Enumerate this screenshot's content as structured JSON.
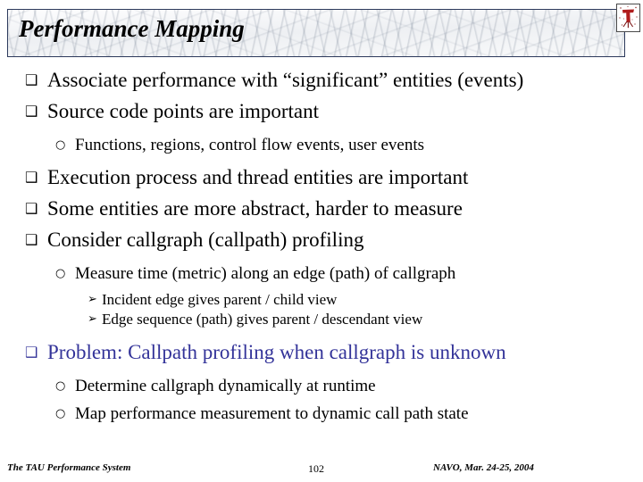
{
  "slide": {
    "title": "Performance Mapping",
    "logo_icon": "tau-logo-icon",
    "accent_color": "#333399",
    "title_border_color": "#2d3a5c",
    "text_color": "#000000"
  },
  "markers": {
    "level1": "❑",
    "level2": "○",
    "level3": "➢"
  },
  "bullets": [
    {
      "level": 1,
      "text": "Associate performance with “significant” entities (events)",
      "color": "#000000"
    },
    {
      "level": 1,
      "text": "Source code points are important",
      "color": "#000000"
    },
    {
      "level": 2,
      "text": "Functions, regions, control flow events, user events",
      "color": "#000000"
    },
    {
      "level": 1,
      "text": "Execution process and thread entities are important",
      "color": "#000000"
    },
    {
      "level": 1,
      "text": "Some entities are more abstract,  harder to measure",
      "color": "#000000"
    },
    {
      "level": 1,
      "text": "Consider callgraph (callpath) profiling",
      "color": "#000000"
    },
    {
      "level": 2,
      "text": "Measure time (metric) along an edge (path) of callgraph",
      "color": "#000000"
    },
    {
      "level": 3,
      "text": "Incident edge gives parent / child view",
      "color": "#000000"
    },
    {
      "level": 3,
      "text": "Edge sequence (path) gives parent / descendant view",
      "color": "#000000"
    },
    {
      "level": 1,
      "text": "Problem: Callpath profiling when callgraph is unknown",
      "color": "#333399"
    },
    {
      "level": 2,
      "text": "Determine callgraph dynamically at runtime",
      "color": "#000000"
    },
    {
      "level": 2,
      "text": "Map performance measurement to dynamic call path state",
      "color": "#000000"
    }
  ],
  "footer": {
    "left": "The TAU Performance System",
    "page_number": "102",
    "right": "NAVO, Mar. 24-25, 2004"
  }
}
